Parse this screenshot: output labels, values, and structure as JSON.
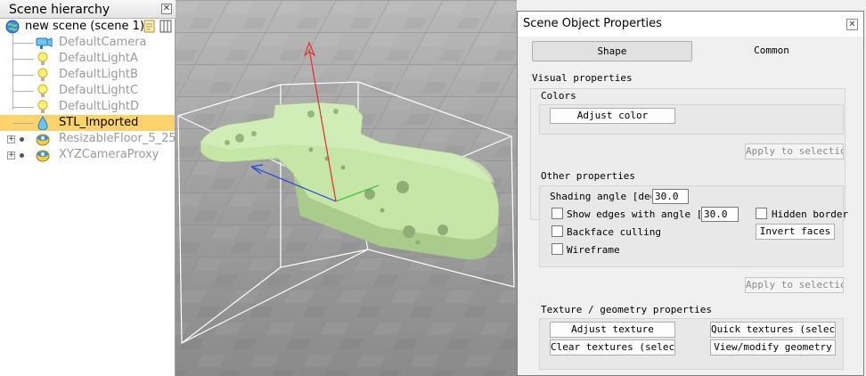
{
  "hierarchy": {
    "title": "Scene hierarchy",
    "close": "✕",
    "root": "new scene (scene 1)",
    "items": [
      {
        "label": "DefaultCamera",
        "icon": "camera-icon"
      },
      {
        "label": "DefaultLightA",
        "icon": "light-icon"
      },
      {
        "label": "DefaultLightB",
        "icon": "light-icon"
      },
      {
        "label": "DefaultLightC",
        "icon": "light-icon"
      },
      {
        "label": "DefaultLightD",
        "icon": "light-icon"
      },
      {
        "label": "STL_Imported",
        "icon": "shape-icon"
      },
      {
        "label": "ResizableFloor_5_25",
        "icon": "model-icon"
      },
      {
        "label": "XYZCameraProxy",
        "icon": "model-icon"
      }
    ],
    "expand_symbol": "+"
  },
  "props": {
    "title": "Scene Object Properties",
    "close": "✕",
    "tabs": [
      "Shape",
      "Common"
    ],
    "visual": "Visual properties",
    "colors": "Colors",
    "adjust_color": "Adjust color",
    "apply": "Apply to selection",
    "other": "Other properties",
    "shading_label": "Shading angle [deg]",
    "shading_value": "30.0",
    "edges_label": "Show edges with angle [deg]",
    "edges_value": "30.0",
    "hidden_border": "Hidden border",
    "backface": "Backface culling",
    "invert_faces": "Invert faces",
    "wireframe": "Wireframe",
    "apply2": "Apply to selection",
    "texture": "Texture / geometry properties",
    "adjust_texture": "Adjust texture",
    "quick_textures": "Quick textures (selection)",
    "clear_textures": "Clear textures (selection)",
    "view_geometry": "View/modify geometry"
  },
  "colors": {
    "selection": "#ffd36b",
    "shape": "#c6e6a8",
    "axis_x": "#e03030",
    "axis_y": "#2040e0",
    "axis_z": "#30c030"
  }
}
